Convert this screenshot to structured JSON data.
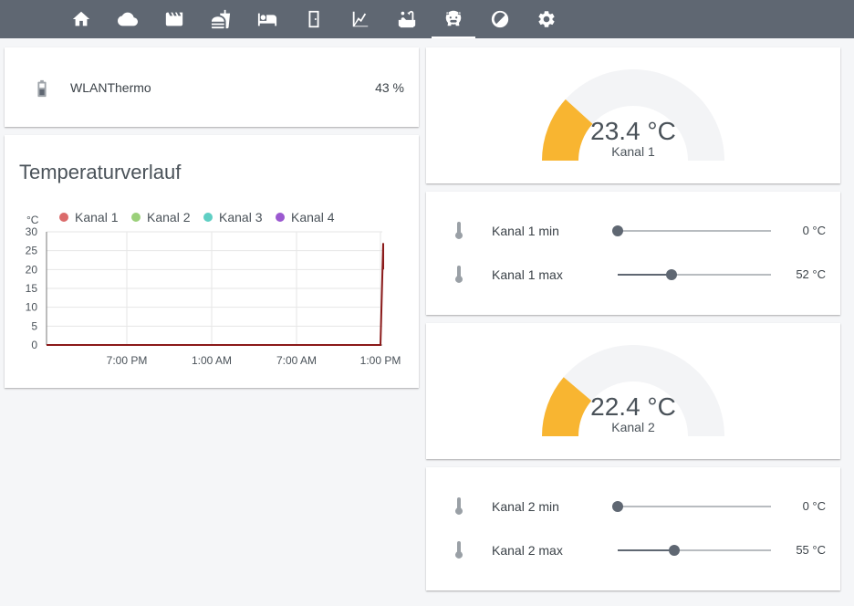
{
  "nav": {
    "tabs": [
      {
        "icon": "home-icon",
        "active": false
      },
      {
        "icon": "cloud-icon",
        "active": false
      },
      {
        "icon": "movie-icon",
        "active": false
      },
      {
        "icon": "food-icon",
        "active": false
      },
      {
        "icon": "bed-icon",
        "active": false
      },
      {
        "icon": "door-icon",
        "active": false
      },
      {
        "icon": "chart-icon",
        "active": false
      },
      {
        "icon": "bathtub-icon",
        "active": false
      },
      {
        "icon": "pig-icon",
        "active": true
      },
      {
        "icon": "circle-slash-icon",
        "active": false
      },
      {
        "icon": "gear-icon",
        "active": false
      }
    ]
  },
  "battery": {
    "name": "WLANThermo",
    "value": "43 %",
    "level": 43
  },
  "history": {
    "title": "Temperaturverlauf",
    "chart_data": {
      "type": "line",
      "ylabel": "°C",
      "ylim": [
        0,
        30
      ],
      "y_ticks": [
        "0",
        "5",
        "10",
        "15",
        "20",
        "25",
        "30"
      ],
      "x_ticks": [
        "7:00 PM",
        "1:00 AM",
        "7:00 AM",
        "1:00 PM"
      ],
      "grid": true,
      "legend_position": "top",
      "series": [
        {
          "name": "Kanal 1",
          "color": "#db6b6b",
          "values": [
            0,
            0,
            0,
            0,
            0,
            27,
            20
          ]
        },
        {
          "name": "Kanal 2",
          "color": "#9bd07a",
          "values": []
        },
        {
          "name": "Kanal 3",
          "color": "#5fcfc4",
          "values": []
        },
        {
          "name": "Kanal 4",
          "color": "#9b59d0",
          "values": []
        }
      ]
    }
  },
  "gauges": [
    {
      "value": "23.4 °C",
      "name": "Kanal 1",
      "fraction": 0.234,
      "color": "#f8b531"
    },
    {
      "value": "22.4 °C",
      "name": "Kanal 2",
      "fraction": 0.224,
      "color": "#f8b531"
    }
  ],
  "sliders": [
    {
      "label": "Kanal 1 min",
      "value": "0 °C",
      "fraction": 0.0
    },
    {
      "label": "Kanal 1 max",
      "value": "52 °C",
      "fraction": 0.35
    },
    {
      "label": "Kanal 2 min",
      "value": "0 °C",
      "fraction": 0.0
    },
    {
      "label": "Kanal 2 max",
      "value": "55 °C",
      "fraction": 0.37
    }
  ],
  "colors": {
    "header": "#5f6772",
    "gauge_fill": "#f8b531",
    "gauge_track": "#f3f4f6",
    "line": "#8b1a1a"
  }
}
